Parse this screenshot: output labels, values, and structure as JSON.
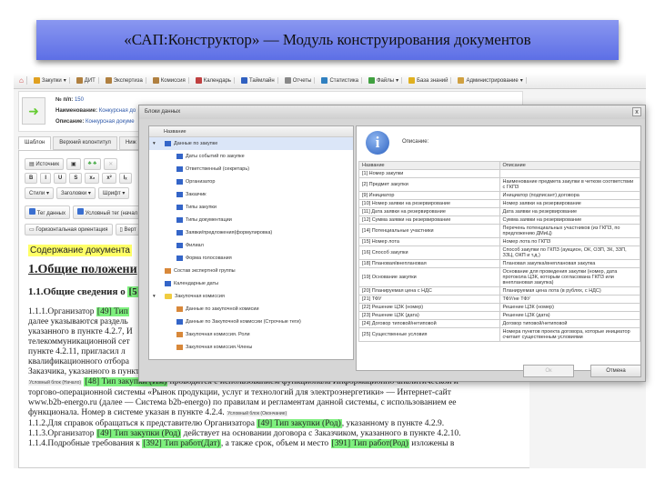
{
  "slide_title": "«САП:Конструктор» — Модуль конструирования документов",
  "toolbar": [
    "Закупки",
    "ДИТ",
    "Экспертиза",
    "Комиссия",
    "Календарь",
    "Таймлайн",
    "Отчеты",
    "Статистика",
    "Файлы",
    "База знаний",
    "Администрирование"
  ],
  "header": {
    "num_label": "№ п/п:",
    "num": "150",
    "name_label": "Наименование:",
    "name": "Конкурсная до",
    "desc_label": "Описание:",
    "desc": "Конкурсная докуме"
  },
  "tabs": [
    "Шаблон",
    "Верхний колонтитул",
    "Ниж"
  ],
  "editor": {
    "row1": [
      "Источник"
    ],
    "row2": [
      "B",
      "I",
      "U",
      "S",
      "x₂",
      "x²",
      "Iₓ"
    ],
    "row3": [
      "Стили ▾",
      "Заголовки ▾",
      "Шрифт ▾"
    ],
    "row4": [
      "Тег данных",
      "Условный тег (начал"
    ],
    "row5": [
      "Горизонтальная ориентация",
      "Верт"
    ]
  },
  "doc": {
    "content_label": "Содержание документа",
    "h1": "1.Общие положени",
    "h2": "1.1.Общие сведения о",
    "h2_tag": "[5",
    "l1a": "1.1.1.Организатор ",
    "l1_tag": "[49] Тип",
    "l2": "далее указываются раздель",
    "l3": "указанного в пункте 4.2.7, И",
    "l4": "телекоммуникационной сет",
    "l5": "пункте 4.2.11, пригласил л",
    "l6": "квалификационного отбора",
    "l7": "Заказчика, указанного в пункте 4.2.7.",
    "cond_start": "Условный блок (Начало)",
    "l8_tag": "[48] Тип закупки (Им)",
    "l8": " проводится с использованием функционала Информационно-аналитической и",
    "l9": "торгово-операционной системы «Рынок продукции, услуг и технологий для электроэнергетики» — Интернет-сайт",
    "l10": "www.b2b-energo.ru  (далее — Система b2b-energo) по правилам и регламентам данной системы, с использованием ее",
    "l11": "функционала. Номер в системе указан в пункте 4.2.4. ",
    "cond_end": "Условный блок (Окончание)",
    "l12a": "1.1.2.Для справок обращаться к представителю Организатора ",
    "l12_tag": "[49] Тип закупки (Род)",
    "l12b": ", указанному в пункте 4.2.9.",
    "l13a": "1.1.3.Организатор ",
    "l13_tag": "[49] Тип закупки (Род)",
    "l13b": " действует на основании договора с Заказчиком, указанного в пункте 4.2.10.",
    "l14a": "1.1.4.Подробные требования к ",
    "l14_tag1": "[392] Тип работ(Дат)",
    "l14b": ", а также срок, объем и место ",
    "l14_tag2": "[391] Тип работ(Род)",
    "l14c": " изложены в"
  },
  "dialog": {
    "title": "Блоки данных",
    "close": "x",
    "tree_header": "Название",
    "tree": [
      {
        "label": "Данные по закупке",
        "level": 0,
        "icon": "block",
        "sel": true,
        "exp": true
      },
      {
        "label": "Даты событий по закупке",
        "level": 1,
        "icon": "block"
      },
      {
        "label": "Ответственный (секретарь)",
        "level": 1,
        "icon": "block"
      },
      {
        "label": "Организатор",
        "level": 1,
        "icon": "block"
      },
      {
        "label": "Заказчик",
        "level": 1,
        "icon": "block"
      },
      {
        "label": "Типы закупки",
        "level": 1,
        "icon": "block"
      },
      {
        "label": "Типы документации",
        "level": 1,
        "icon": "block"
      },
      {
        "label": "Заявки/предложения(формулировка)",
        "level": 1,
        "icon": "block"
      },
      {
        "label": "Филиал",
        "level": 1,
        "icon": "block"
      },
      {
        "label": "Форма голосования",
        "level": 1,
        "icon": "block"
      },
      {
        "label": "Состав экспертной группы",
        "level": 0,
        "icon": "grid"
      },
      {
        "label": "Календарные даты",
        "level": 0,
        "icon": "block"
      },
      {
        "label": "Закупочная комиссия",
        "level": 0,
        "icon": "folder",
        "exp": true
      },
      {
        "label": "Данные по закупочной комисии",
        "level": 1,
        "icon": "grid"
      },
      {
        "label": "Данные по Закупочной комиссии (Строчные теги)",
        "level": 1,
        "icon": "block"
      },
      {
        "label": "Закупочная комиссия. Роли",
        "level": 1,
        "icon": "grid"
      },
      {
        "label": "Закупочная комиссия.Члены",
        "level": 1,
        "icon": "grid"
      }
    ],
    "desc_label": "Описание:",
    "table_headers": [
      "Название",
      "Описание"
    ],
    "rows": [
      [
        "[1] Номер закупки",
        ""
      ],
      [
        "[2] Предмет закупки",
        "Наименование предмета закупки в четком соответствии с ГКПЗ"
      ],
      [
        "[9] Инициатор",
        "Инициатор (подписант) договора"
      ],
      [
        "[10] Номер заявки на резервирование",
        "Номер заявки на резервирование"
      ],
      [
        "[11] Дата заявки на резервирование",
        "Дата заявки на резервирование"
      ],
      [
        "[12] Сумма заявки на резервирование",
        "Сумма заявки на резервирование"
      ],
      [
        "[14] Потенциальные участники",
        "Перечень потенциальных участников (из ГКПЗ, по предложению ДМиЦ)"
      ],
      [
        "[15] Номер лота",
        "Номер лота по ГКПЗ"
      ],
      [
        "[16] Способ закупки",
        "Способ закупки по ГКПЗ (аукцион, ОК, ОЗП, ЗК, ЗЗП, ЗЗЦ, ОКП и т.д.)"
      ],
      [
        "[18] Плановая/внеплановая",
        "Плановая закупка/внеплановая закупка"
      ],
      [
        "[19] Основание закупки",
        "Основание для проведения закупки (номер, дата протокола ЦЗК, которым согласована ГКПЗ  или внеплановая закупка)"
      ],
      [
        "[20] Планируемая цена с НДС",
        "Планируемая цена лота (в рублях, с НДС)"
      ],
      [
        "[21] ТФУ",
        "ТФУ/не ТФУ"
      ],
      [
        "[22] Решение ЦЗК (номер)",
        "Решение ЦЗК (номер)"
      ],
      [
        "[23] Решение ЦЗК (дата)",
        "Решение ЦЗК (дата)"
      ],
      [
        "[24] Договор типовой/нетиповой",
        "Договор типовой/нетиповой"
      ],
      [
        "[25] Существенные условия",
        "Номера пунктов проекта договора, которые инициатор считает существенным условиями"
      ]
    ],
    "ok": "Ок",
    "cancel": "Отмена"
  }
}
